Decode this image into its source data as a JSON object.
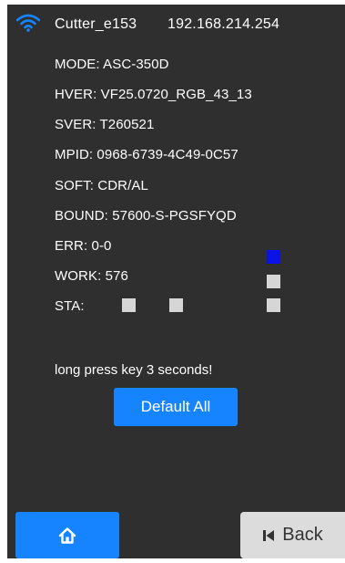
{
  "header": {
    "device_name": "Cutter_e153",
    "ip": "192.168.214.254",
    "wifi_icon": "wifi-icon"
  },
  "info": {
    "mode": "MODE: ASC-350D",
    "hver": "HVER: VF25.0720_RGB_43_13",
    "sver": "SVER: T260521",
    "mpid": "MPID: 0968-6739-4C49-0C57",
    "soft": "SOFT: CDR/AL",
    "bound": "BOUND: 57600-S-PGSFYQD",
    "err": "ERR: 0-0",
    "work": "WORK: 576",
    "sta": "STA:"
  },
  "indicators": {
    "colors": {
      "gray": "#d6d6d6",
      "blue": "#0a12e6"
    }
  },
  "hint": "long press key 3 seconds!",
  "default_button": "Default All",
  "nav": {
    "home_icon": "home-icon",
    "back_icon": "skip-back-icon",
    "back_label": "Back"
  },
  "colors": {
    "screen_bg": "#2f2f2f",
    "accent": "#1684ff",
    "back_bg": "#dcdcdc"
  }
}
